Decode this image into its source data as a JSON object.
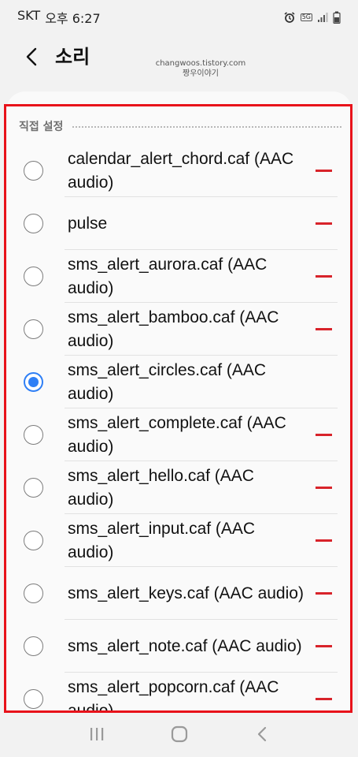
{
  "status_bar": {
    "carrier": "SKT",
    "time": "오후 6:27",
    "network_badge": "5G",
    "icons": [
      "alarm-icon",
      "network-5g-icon",
      "signal-icon",
      "battery-icon"
    ]
  },
  "header": {
    "title": "소리",
    "back_icon": "chevron-left-icon"
  },
  "watermark": {
    "line1": "changwoos.tistory.com",
    "line2": "짱우이야기"
  },
  "section": {
    "label": "직접 설정"
  },
  "items": [
    {
      "label": "calendar_alert_chord.caf (AAC audio)",
      "selected": false,
      "removable": true
    },
    {
      "label": "pulse",
      "selected": false,
      "removable": true
    },
    {
      "label": "sms_alert_aurora.caf (AAC audio)",
      "selected": false,
      "removable": true
    },
    {
      "label": "sms_alert_bamboo.caf (AAC audio)",
      "selected": false,
      "removable": true
    },
    {
      "label": "sms_alert_circles.caf (AAC audio)",
      "selected": true,
      "removable": false
    },
    {
      "label": "sms_alert_complete.caf (AAC audio)",
      "selected": false,
      "removable": true
    },
    {
      "label": "sms_alert_hello.caf (AAC audio)",
      "selected": false,
      "removable": true
    },
    {
      "label": "sms_alert_input.caf (AAC audio)",
      "selected": false,
      "removable": true
    },
    {
      "label": "sms_alert_keys.caf (AAC audio)",
      "selected": false,
      "removable": true
    },
    {
      "label": "sms_alert_note.caf (AAC audio)",
      "selected": false,
      "removable": true
    },
    {
      "label": "sms_alert_popcorn.caf (AAC audio)",
      "selected": false,
      "removable": true
    }
  ],
  "nav_bar": {
    "icons": [
      "recent-apps-icon",
      "home-icon",
      "back-icon"
    ]
  },
  "colors": {
    "accent": "#2f7ff5",
    "remove": "#d8232a",
    "highlight_border": "#e8121a",
    "background": "#f2f2f2"
  }
}
